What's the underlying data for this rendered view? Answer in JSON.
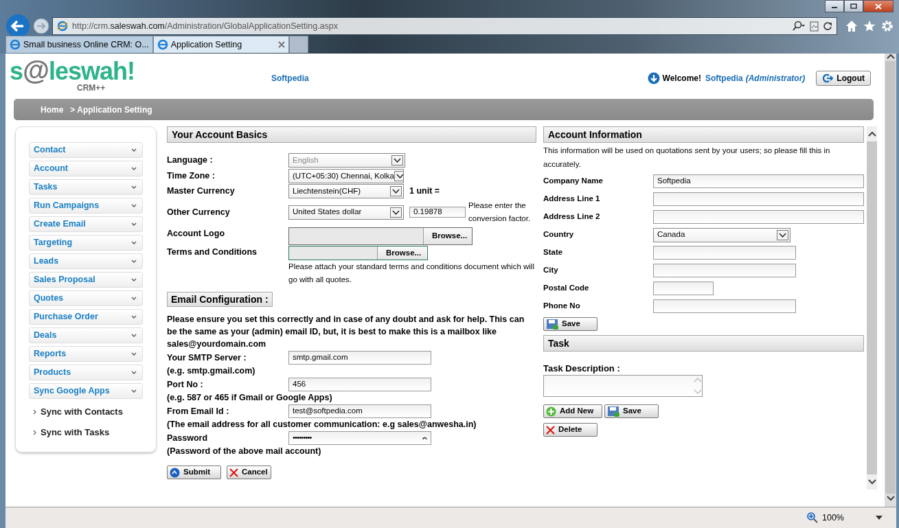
{
  "browser": {
    "address": {
      "prefix": "http://crm.",
      "domain": "saleswah.com",
      "path": "/Administration/GlobalApplicationSetting.aspx"
    },
    "tabs": [
      {
        "label": "Small business Online CRM: O...",
        "selected": false
      },
      {
        "label": "Application Setting",
        "selected": true
      }
    ]
  },
  "header": {
    "logo": {
      "parts": [
        "s",
        "@",
        "leswah!"
      ],
      "subtitle": "CRM++"
    },
    "site_link": "Softpedia",
    "welcome": "Welcome!",
    "user": "Softpedia",
    "role": "(Administrator)",
    "logout": "Logout"
  },
  "breadcrumb": [
    "Home",
    "> Application Setting"
  ],
  "sidebar": {
    "items": [
      {
        "label": "Contact",
        "kind": "menu"
      },
      {
        "label": "Account",
        "kind": "menu"
      },
      {
        "label": "Tasks",
        "kind": "menu"
      },
      {
        "label": "Run Campaigns",
        "kind": "menu"
      },
      {
        "label": "Create Email",
        "kind": "menu"
      },
      {
        "label": "Targeting",
        "kind": "menu"
      },
      {
        "label": "Leads",
        "kind": "menu"
      },
      {
        "label": "Sales Proposal",
        "kind": "menu"
      },
      {
        "label": "Quotes",
        "kind": "menu"
      },
      {
        "label": "Purchase Order",
        "kind": "menu"
      },
      {
        "label": "Deals",
        "kind": "menu"
      },
      {
        "label": "Reports",
        "kind": "menu"
      },
      {
        "label": "Products",
        "kind": "menu"
      },
      {
        "label": "Sync Google Apps",
        "kind": "menu"
      },
      {
        "label": "Sync with Contacts",
        "kind": "sub"
      },
      {
        "label": "Sync with Tasks",
        "kind": "sub"
      }
    ]
  },
  "account_basics": {
    "title": "Your Account Basics",
    "language": {
      "label": "Language :",
      "value": "English",
      "disabled": true
    },
    "time_zone": {
      "label": "Time Zone :",
      "value": "(UTC+05:30) Chennai, Kolka",
      "disabled": false
    },
    "master_currency": {
      "label": "Master Currency",
      "value": "Liechtenstein(CHF)",
      "disabled": false,
      "unit": "1 unit ="
    },
    "other_currency": {
      "label": "Other Currency",
      "value": "United States dollar",
      "disabled": false,
      "rate": "0.19878",
      "note": "Please enter the conversion factor."
    },
    "account_logo": {
      "label": "Account Logo",
      "button": "Browse..."
    },
    "terms": {
      "label": "Terms and Conditions",
      "button": "Browse...",
      "note": "Please attach your standard terms and conditions document which will go with all quotes."
    }
  },
  "email_configuration": {
    "title": "Email Configuration :",
    "intro": "Please ensure you set this correctly and in case of any doubt and ask for help. This can be the same as your (admin) email ID, but, it is best to make this is a mailbox like sales@yourdomain.com",
    "fields": [
      {
        "label": "Your SMTP Server :",
        "value": "smtp.gmail.com",
        "hint": "(e.g. smtp.gmail.com)",
        "kind": "text"
      },
      {
        "label": "Port No :",
        "value": "456",
        "hint": "(e.g. 587 or 465 if Gmail or Google Apps)",
        "kind": "text"
      },
      {
        "label": "From Email Id :",
        "value": "test@softpedia.com",
        "hint": "(The email address for all customer communication: e.g sales@anwesha.in)",
        "kind": "text"
      },
      {
        "label": "Password",
        "value": "•••••••••",
        "hint": "(Password of the above mail account)",
        "kind": "password"
      }
    ],
    "buttons": [
      {
        "label": "Submit",
        "kind": "submit"
      },
      {
        "label": "Cancel",
        "kind": "cancel"
      }
    ]
  },
  "account_information": {
    "title": "Account Information",
    "intro": "This information will be used on quotations sent by your users; so please fill this in accurately.",
    "fields": [
      {
        "label": "Company Name",
        "value": "Softpedia",
        "kind": "wide"
      },
      {
        "label": "Address Line 1",
        "kind": "wide"
      },
      {
        "label": "Address Line 2",
        "kind": "wide"
      },
      {
        "label": "Country",
        "value": "Canada",
        "kind": "select"
      },
      {
        "label": "State",
        "kind": "medium"
      },
      {
        "label": "City",
        "kind": "medium"
      },
      {
        "label": "Postal Code",
        "kind": "short"
      },
      {
        "label": "Phone No",
        "kind": "medium"
      }
    ],
    "save": "Save"
  },
  "task": {
    "title": "Task",
    "description_label": "Task Description :",
    "buttons": [
      {
        "label": "Add New",
        "kind": "add"
      },
      {
        "label": "Save",
        "kind": "save"
      },
      {
        "label": "Delete",
        "kind": "delete"
      }
    ]
  },
  "status_bar": {
    "zoom": "100%"
  }
}
